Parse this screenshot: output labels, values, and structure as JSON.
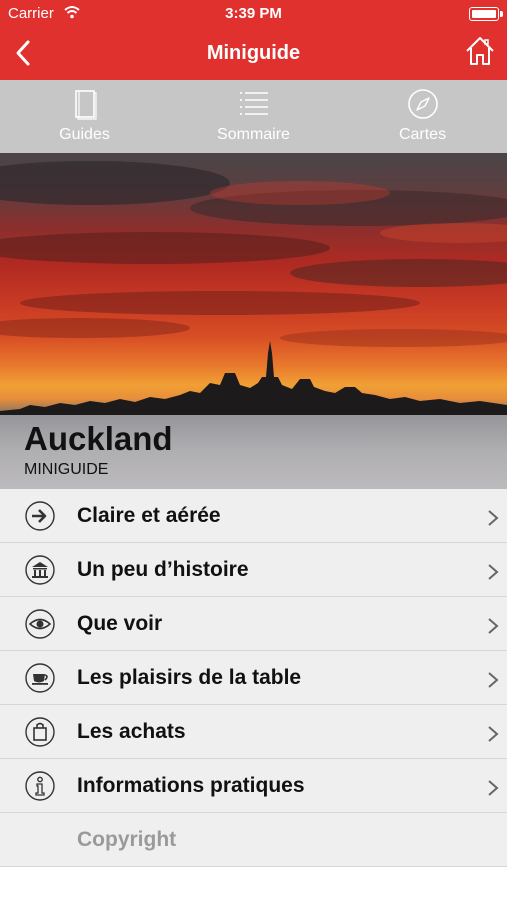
{
  "status_bar": {
    "carrier": "Carrier",
    "time": "3:39 PM"
  },
  "nav": {
    "title": "Miniguide",
    "back_icon": "chevron-left-icon",
    "home_icon": "home-icon"
  },
  "tabs": [
    {
      "label": "Guides",
      "icon": "book-icon"
    },
    {
      "label": "Sommaire",
      "icon": "list-icon"
    },
    {
      "label": "Cartes",
      "icon": "compass-icon"
    }
  ],
  "hero": {
    "city": "Auckland",
    "subtitle": "MINIGUIDE"
  },
  "menu": [
    {
      "label": "Claire et aérée",
      "icon": "arrow-right-circle-icon"
    },
    {
      "label": "Un peu d’histoire",
      "icon": "museum-icon"
    },
    {
      "label": "Que voir",
      "icon": "eye-icon"
    },
    {
      "label": "Les plaisirs de la table",
      "icon": "cup-icon"
    },
    {
      "label": "Les achats",
      "icon": "shopping-bag-icon"
    },
    {
      "label": "Informations pratiques",
      "icon": "info-icon"
    },
    {
      "label": "Copyright",
      "icon": ""
    }
  ],
  "colors": {
    "brand_red": "#e0312f",
    "tab_gray": "#c6c6c6",
    "row_bg": "#efefef"
  }
}
